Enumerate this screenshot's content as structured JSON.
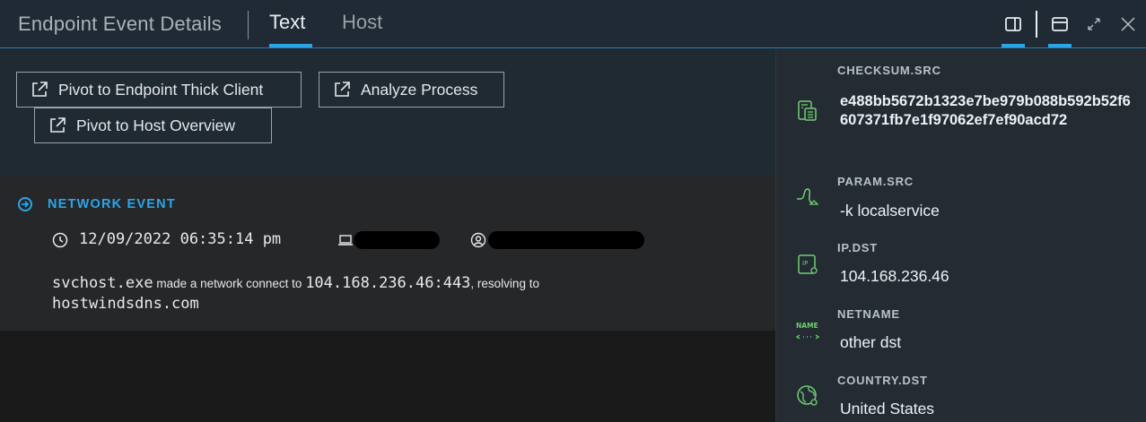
{
  "header": {
    "title": "Endpoint Event Details",
    "tabs": [
      {
        "label": "Text",
        "active": true
      },
      {
        "label": "Host",
        "active": false
      }
    ],
    "icons": [
      "panel-right-icon",
      "panel-top-icon",
      "expand-icon",
      "close-icon"
    ]
  },
  "actions": {
    "pivot_thick_client": "Pivot to Endpoint Thick Client",
    "analyze_process": "Analyze Process",
    "pivot_host_overview": "Pivot to Host Overview"
  },
  "event": {
    "type_label": "NETWORK EVENT",
    "timestamp": "12/09/2022 06:35:14 pm",
    "process": "svchost.exe",
    "text_made": " made a network connect to ",
    "destination": "104.168.236.46:443",
    "text_resolving": ", resolving to",
    "hostname": "hostwindsdns.com"
  },
  "fields": [
    {
      "label": "CHECKSUM.SRC",
      "value": "e488bb5672b1323e7be979b088b592b52f6607371fb7e1f97062ef7ef90acd72",
      "icon": "checksum-icon"
    },
    {
      "label": "PARAM.SRC",
      "value": "-k localservice",
      "icon": "param-icon"
    },
    {
      "label": "IP.DST",
      "value": "104.168.236.46",
      "icon": "ip-icon"
    },
    {
      "label": "NETNAME",
      "value": "other dst",
      "icon": "netname-icon"
    },
    {
      "label": "COUNTRY.DST",
      "value": "United States",
      "icon": "globe-icon"
    }
  ],
  "colors": {
    "accent": "#2aa6e8",
    "icon_green": "#6fcf6f",
    "header_bg": "#1f2a34"
  }
}
